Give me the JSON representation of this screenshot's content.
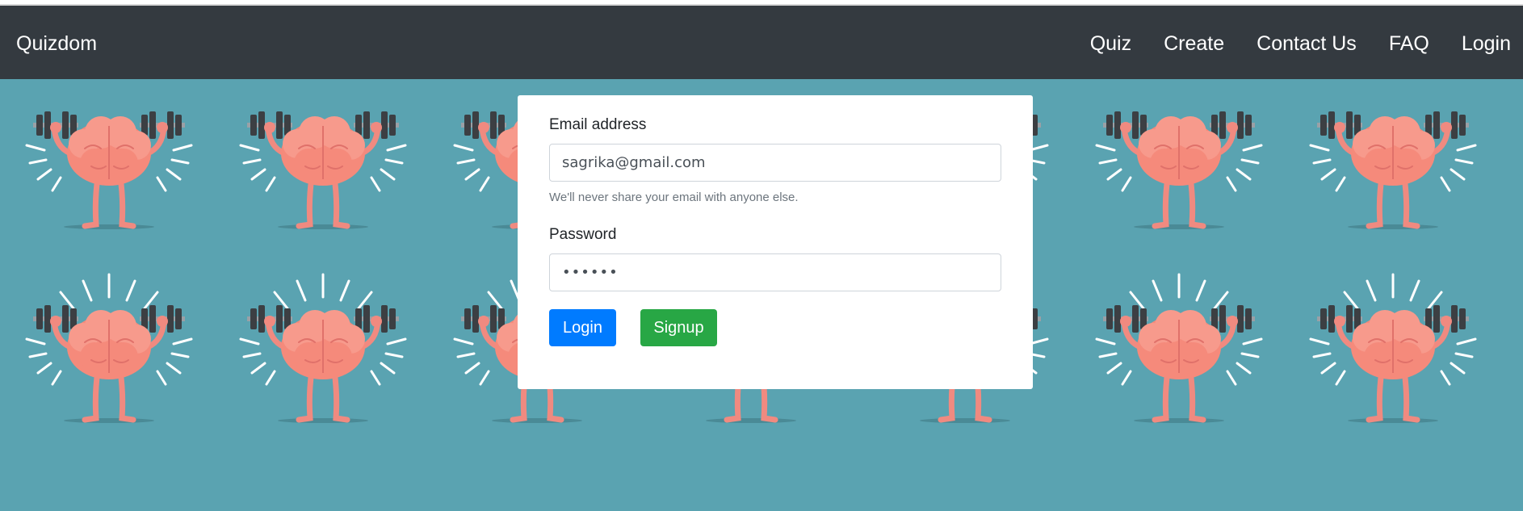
{
  "navbar": {
    "brand": "Quizdom",
    "links": [
      "Quiz",
      "Create",
      "Contact Us",
      "FAQ",
      "Login"
    ],
    "background": "#343a40"
  },
  "background": {
    "color": "#5aa3b1",
    "tile_icon": "brain-lifting-dumbbells-icon"
  },
  "form": {
    "email_label": "Email address",
    "email_value": "sagrika@gmail.com",
    "email_help": "We'll never share your email with anyone else.",
    "password_label": "Password",
    "password_value": "••••••",
    "login_button": "Login",
    "signup_button": "Signup",
    "login_color": "#007bff",
    "signup_color": "#28a745"
  }
}
